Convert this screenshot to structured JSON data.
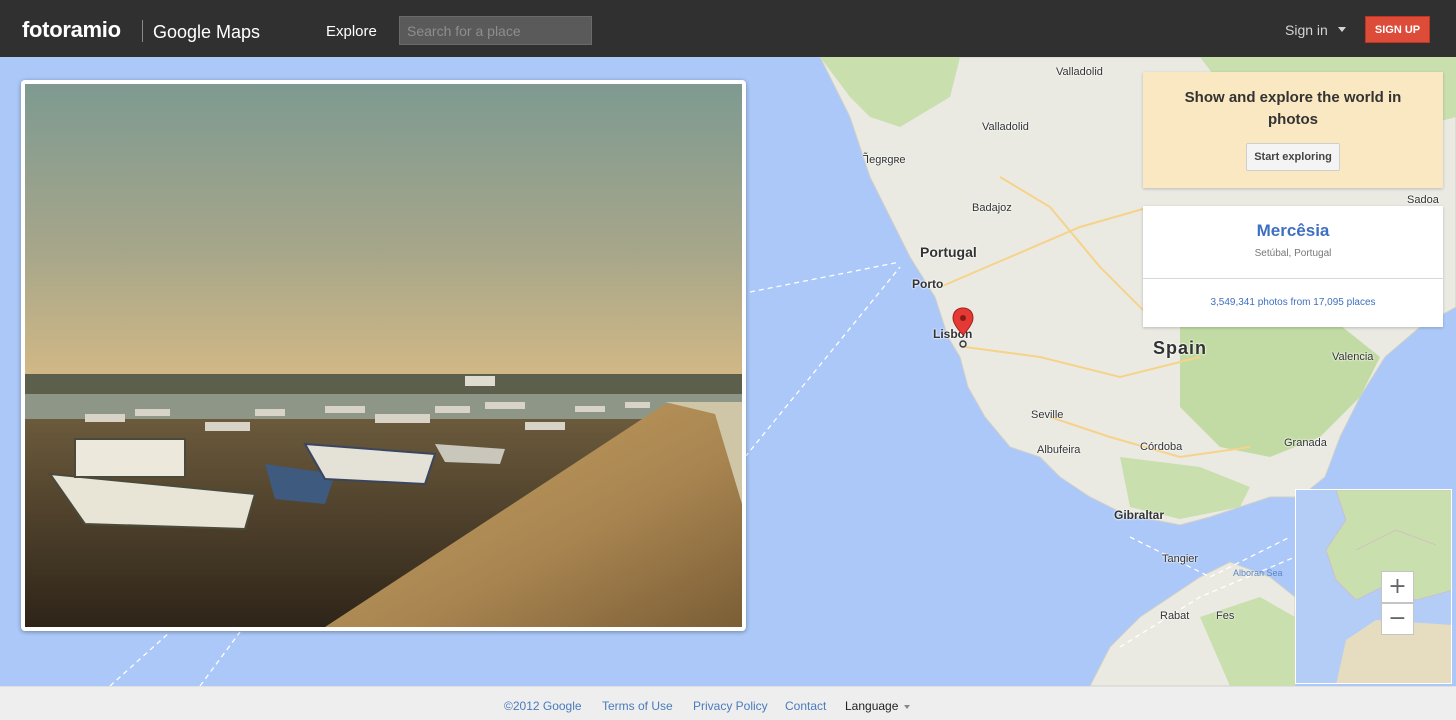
{
  "header": {
    "brand": "fotoramio",
    "brand_sub": "Google Maps",
    "explore_label": "Explore",
    "search_placeholder": "Search for a place",
    "signin_label": "Sign in",
    "signup_label": "SIGN UP"
  },
  "promo": {
    "text": "Show and explore the world in photos",
    "button_label": "Start exploring"
  },
  "place": {
    "name": "Mercêsia",
    "region": "Setúbal, Portugal",
    "stats": "3,549,341 photos from 17,095 places"
  },
  "map": {
    "labels": {
      "valladolid_n": "Valladolid",
      "valladolid": "Valladolid",
      "coimbra": "Ꞁ̃eɡʀɡʀe",
      "badajoz": "Badajoz",
      "portugal": "Portugal",
      "porto": "Porto",
      "lisbon": "Lisbon",
      "spain": "Spain",
      "valencia": "Valencia",
      "seville": "Seville",
      "cordoba": "Córdoba",
      "granada": "Granada",
      "gibraltar": "Gibraltar",
      "tangier": "Tangier",
      "rabat": "Rabat",
      "fes": "Fes",
      "albufeira": "Albufeira",
      "sadoa": "Sadoa",
      "alboran": "Alboran Sea"
    },
    "zoom_in": "+",
    "zoom_out": "−"
  },
  "footer": {
    "copyright": "©2012 Google",
    "terms": "Terms of Use",
    "privacy": "Privacy Policy",
    "contact": "Contact",
    "language": "Language"
  },
  "colors": {
    "topbar": "#303030",
    "signup": "#dd4b39",
    "sea": "#abc8f8",
    "promo_bg": "#fae8c2",
    "link": "#3f6fc0"
  }
}
